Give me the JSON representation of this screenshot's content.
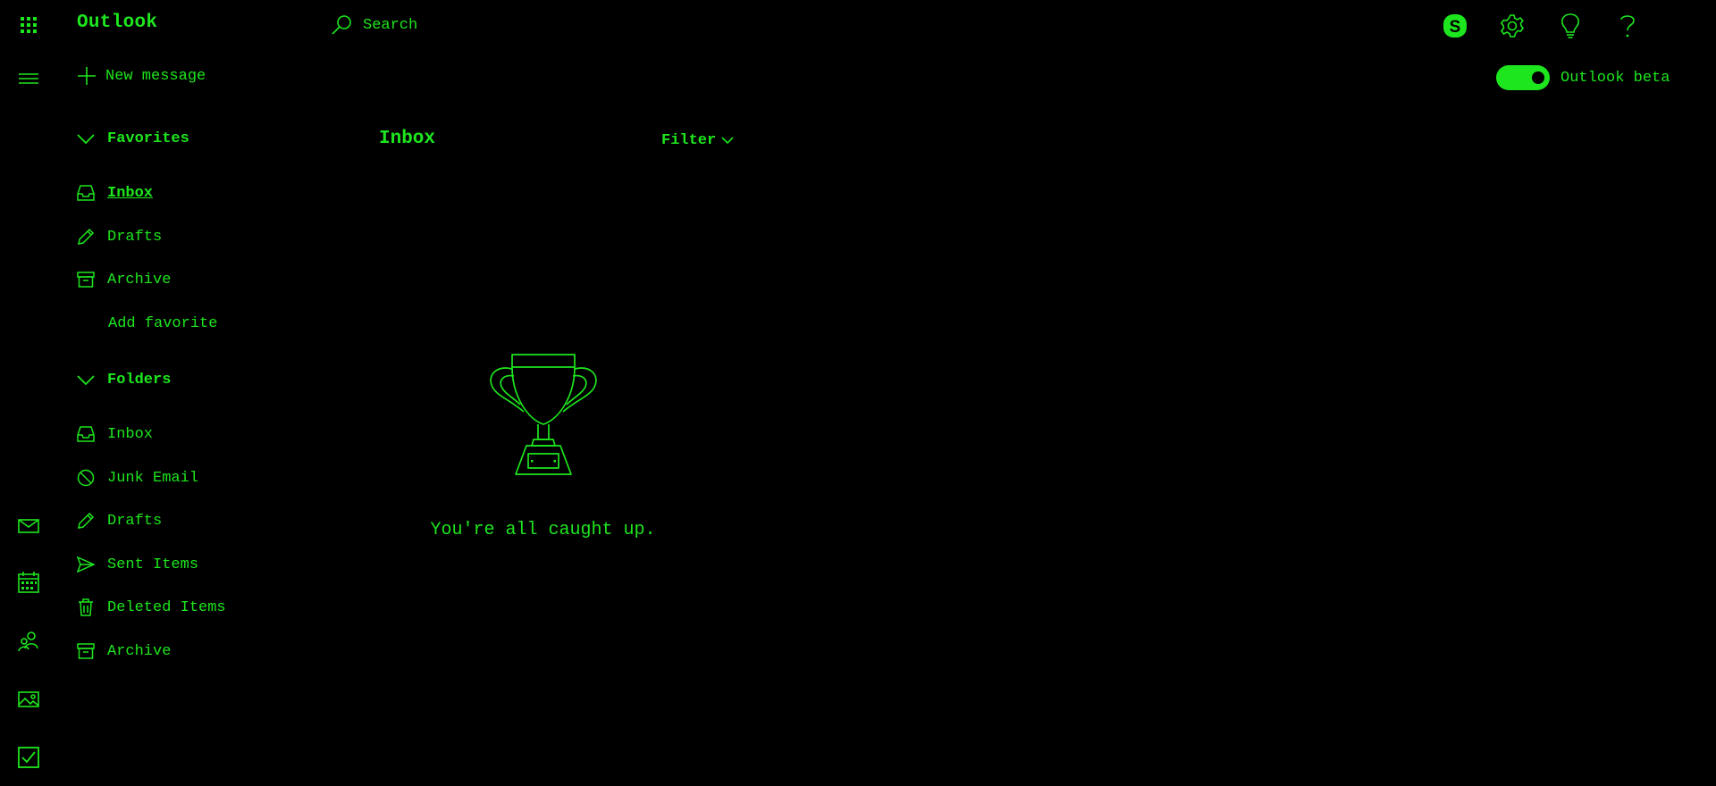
{
  "app": {
    "name": "Outlook"
  },
  "search": {
    "placeholder": "Search"
  },
  "toolbar": {
    "new_message_label": "New message",
    "beta_toggle_label": "Outlook beta",
    "beta_enabled": true
  },
  "top_icons": [
    "skype-icon",
    "gear-icon",
    "lightbulb-icon",
    "help-icon"
  ],
  "favorites": {
    "heading": "Favorites",
    "items": [
      {
        "label": "Inbox",
        "icon": "inbox-icon",
        "active": true
      },
      {
        "label": "Drafts",
        "icon": "pencil-icon"
      },
      {
        "label": "Archive",
        "icon": "archive-icon"
      }
    ],
    "add_label": "Add favorite"
  },
  "folders": {
    "heading": "Folders",
    "items": [
      {
        "label": "Inbox",
        "icon": "inbox-icon"
      },
      {
        "label": "Junk Email",
        "icon": "block-icon"
      },
      {
        "label": "Drafts",
        "icon": "pencil-icon"
      },
      {
        "label": "Sent Items",
        "icon": "send-icon"
      },
      {
        "label": "Deleted Items",
        "icon": "trash-icon"
      },
      {
        "label": "Archive",
        "icon": "archive-icon"
      }
    ]
  },
  "message_list": {
    "title": "Inbox",
    "filter_label": "Filter",
    "empty_text": "You're all caught up."
  },
  "rail": [
    "mail-icon",
    "calendar-icon",
    "people-icon",
    "photos-icon",
    "tasks-icon"
  ],
  "colors": {
    "accent": "#1ee61e",
    "background": "#000000"
  }
}
